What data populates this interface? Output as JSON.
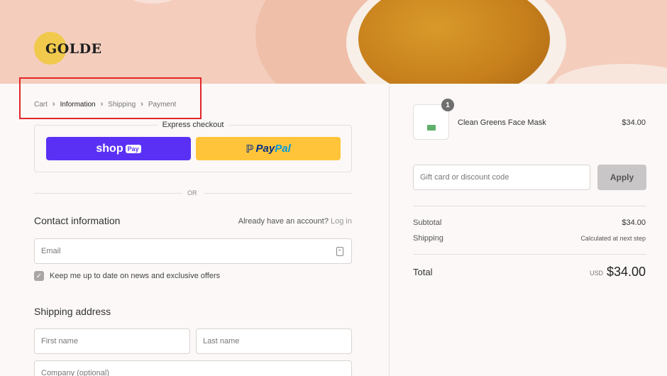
{
  "brand": {
    "logo_text": "GOLDE"
  },
  "breadcrumb": [
    "Cart",
    "Information",
    "Shipping",
    "Payment"
  ],
  "express": {
    "title": "Express checkout",
    "shop_pay_label": "shop",
    "shop_pay_chip": "Pay",
    "paypal_p": "Pay",
    "paypal_pal": "Pal"
  },
  "divider": {
    "or_label": "OR"
  },
  "contact": {
    "heading": "Contact information",
    "account_prompt": "Already have an account?",
    "login_link": "Log in",
    "email_placeholder": "Email",
    "newsletter_label": "Keep me up to date on news and exclusive offers",
    "newsletter_checked": true
  },
  "shipping": {
    "heading": "Shipping address",
    "first_name_placeholder": "First name",
    "last_name_placeholder": "Last name",
    "company_placeholder": "Company (optional)"
  },
  "order": {
    "items": [
      {
        "name": "Clean Greens Face Mask",
        "price": "$34.00",
        "quantity": "1"
      }
    ],
    "discount_placeholder": "Gift card or discount code",
    "apply_label": "Apply",
    "subtotal_label": "Subtotal",
    "subtotal_value": "$34.00",
    "shipping_label": "Shipping",
    "shipping_value": "Calculated at next step",
    "total_label": "Total",
    "total_currency": "USD",
    "total_value": "$34.00"
  },
  "colors": {
    "shop_pay": "#5a31f4",
    "paypal": "#ffc43a",
    "highlight": "#e2262a",
    "banner": "#f4cdbd"
  }
}
